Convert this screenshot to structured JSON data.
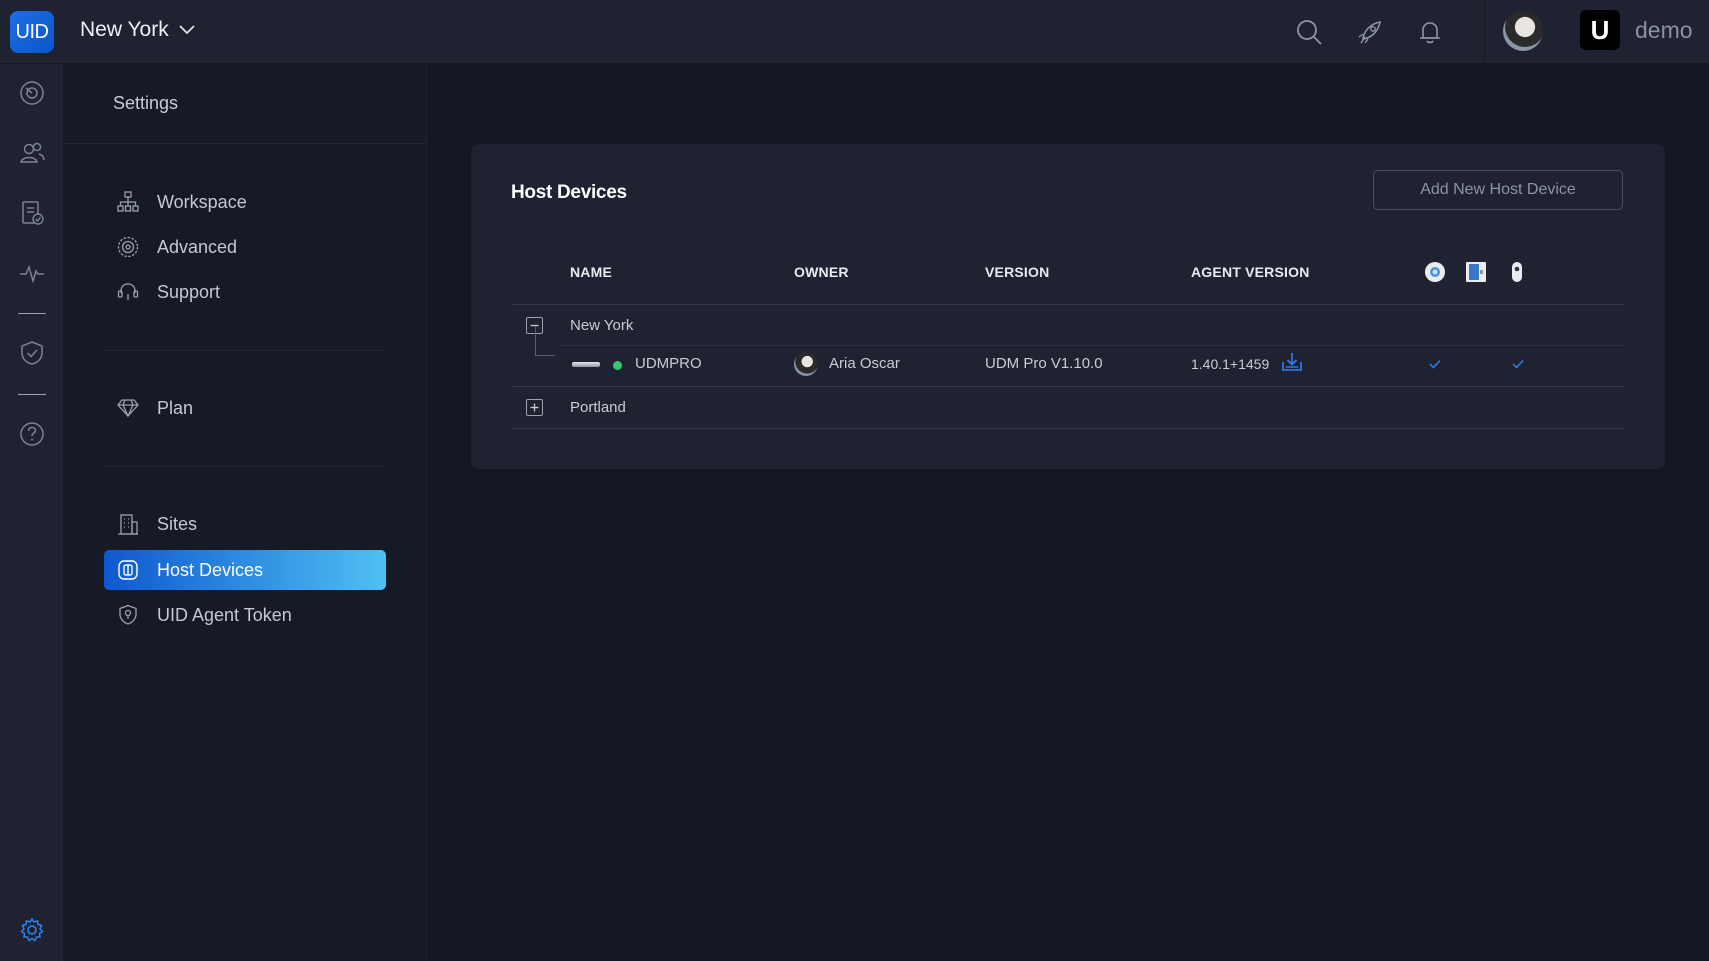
{
  "app": {
    "logo_text": "UID",
    "site_selector": "New York",
    "brand_letter": "U",
    "brand_name": "demo",
    "accent_color": "#1d6fe8"
  },
  "topbar_icons": [
    "search-icon",
    "rocket-icon",
    "bell-icon"
  ],
  "rail_icons": [
    "dashboard-icon",
    "users-icon",
    "reports-icon",
    "activity-icon",
    "shield-icon",
    "help-icon",
    "settings-gear-icon"
  ],
  "settings": {
    "title": "Settings",
    "menu": {
      "workspace": "Workspace",
      "advanced": "Advanced",
      "support": "Support",
      "plan": "Plan",
      "sites": "Sites",
      "host_devices": "Host Devices",
      "agent_token": "UID Agent Token"
    },
    "active_item": "Host Devices"
  },
  "host_devices": {
    "title": "Host Devices",
    "add_button": "Add New Host Device",
    "columns": {
      "name": "NAME",
      "owner": "OWNER",
      "version": "VERSION",
      "agent_version": "AGENT VERSION"
    },
    "column_icons": [
      "camera-icon",
      "door-access-icon",
      "intercom-icon"
    ],
    "groups": [
      {
        "label": "New York",
        "expanded": true,
        "devices": [
          {
            "name": "UDMPRO",
            "status": "online",
            "owner": "Aria Oscar",
            "version": "UDM Pro V1.10.0",
            "agent_version": "1.40.1+1459",
            "checks": [
              false,
              true,
              true
            ]
          }
        ]
      },
      {
        "label": "Portland",
        "expanded": false
      }
    ],
    "check_color": "#2f7ff7",
    "online_color": "#38c76c"
  }
}
